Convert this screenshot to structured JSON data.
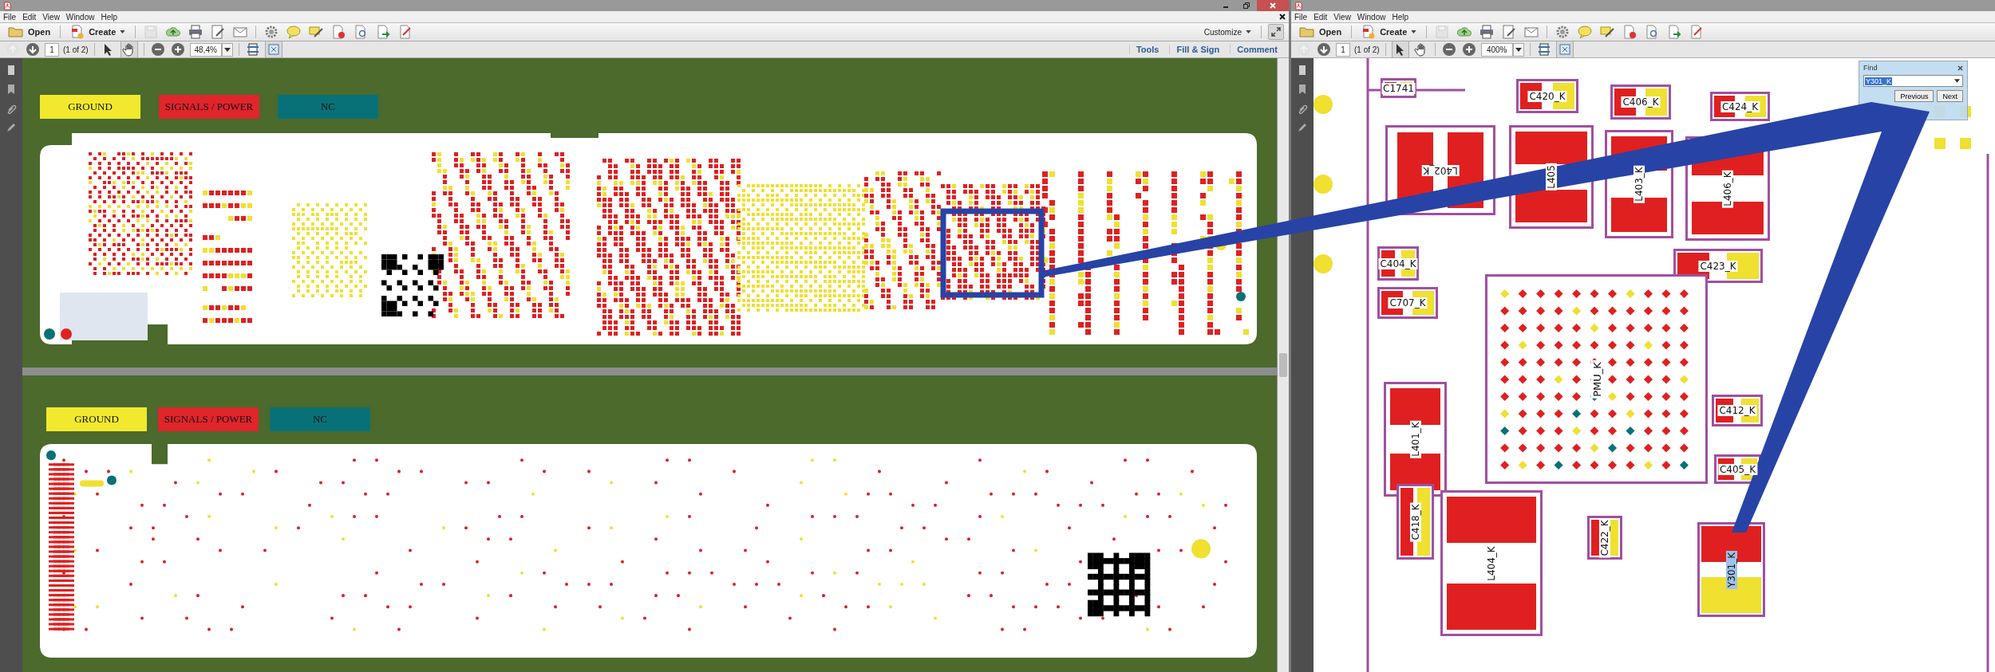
{
  "left_window": {
    "menu": [
      "File",
      "Edit",
      "View",
      "Window",
      "Help"
    ],
    "toolbar": {
      "open_label": "Open",
      "create_label": "Create",
      "customize_label": "Customize"
    },
    "navigation": {
      "page": "1",
      "page_count": "(1 of 2)",
      "zoom": "48,4%"
    },
    "panel_links": [
      "Tools",
      "Fill & Sign",
      "Comment"
    ],
    "pages": [
      {
        "legend": [
          {
            "label": "GROUND",
            "color": "#f2e92e"
          },
          {
            "label": "SIGNALS / POWER",
            "color": "#e0252b"
          },
          {
            "label": "NC",
            "color": "#087177"
          }
        ]
      },
      {
        "legend": [
          {
            "label": "GROUND",
            "color": "#f2e92e"
          },
          {
            "label": "SIGNALS / POWER",
            "color": "#e0252b"
          },
          {
            "label": "NC",
            "color": "#087177"
          }
        ]
      }
    ]
  },
  "right_window": {
    "menu": [
      "File",
      "Edit",
      "View",
      "Window",
      "Help"
    ],
    "toolbar": {
      "open_label": "Open",
      "create_label": "Create"
    },
    "navigation": {
      "page": "1",
      "page_count": "(1 of 2)",
      "zoom": "400%"
    },
    "find": {
      "title": "Find",
      "value": "Y301_K",
      "buttons": [
        "Previous",
        "Next"
      ]
    },
    "components": [
      {
        "label": "C1741",
        "kind": "capacitor"
      },
      {
        "label": "C420_K",
        "kind": "capacitor"
      },
      {
        "label": "C406_K",
        "kind": "capacitor"
      },
      {
        "label": "C424_K",
        "kind": "capacitor"
      },
      {
        "label": "L402_K",
        "kind": "inductor"
      },
      {
        "label": "L405",
        "kind": "inductor"
      },
      {
        "label": "L403_K",
        "kind": "inductor"
      },
      {
        "label": "L406_K",
        "kind": "inductor"
      },
      {
        "label": "C404_K",
        "kind": "capacitor"
      },
      {
        "label": "C707_K",
        "kind": "capacitor"
      },
      {
        "label": "C423_K",
        "kind": "capacitor"
      },
      {
        "label": "L401_K",
        "kind": "inductor"
      },
      {
        "label": "C412_K",
        "kind": "capacitor"
      },
      {
        "label": "C405_K",
        "kind": "capacitor"
      },
      {
        "label": "C418_K",
        "kind": "capacitor"
      },
      {
        "label": "L404_K",
        "kind": "inductor"
      },
      {
        "label": "C422_K",
        "kind": "capacitor"
      },
      {
        "label": "Y301_K",
        "kind": "crystal"
      },
      {
        "label": "PMU_K",
        "kind": "chip"
      }
    ]
  }
}
